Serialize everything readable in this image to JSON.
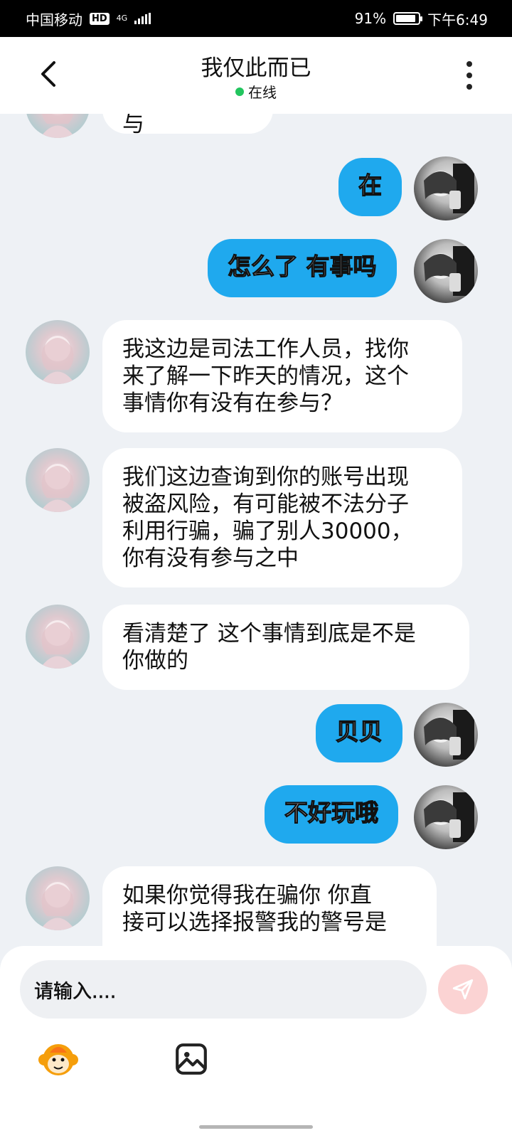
{
  "status_bar": {
    "carrier": "中国移动",
    "hd": "HD",
    "network": "4G",
    "battery": "91%",
    "battery_level": 0.91,
    "time": "下午6:49"
  },
  "header": {
    "title": "我仅此而已",
    "status": "在线",
    "status_color": "#22c55e"
  },
  "messages": [
    {
      "side": "them",
      "text": "有没有在参与"
    },
    {
      "side": "me",
      "text": "在"
    },
    {
      "side": "me",
      "text": "怎么了 有事吗"
    },
    {
      "side": "them",
      "lines": [
        "我这边是司法工作人员，找你",
        "来了解一下昨天的情况，这个",
        "事情你有没有在参与？"
      ]
    },
    {
      "side": "them",
      "lines": [
        "我们这边查询到你的账号出现",
        "被盗风险，有可能被不法分子",
        "利用行骗，骗了别人30000，",
        "你有没有参与之中"
      ]
    },
    {
      "side": "them",
      "lines": [
        "看清楚了 这个事情到底是不是",
        "你做的"
      ]
    },
    {
      "side": "me",
      "text": "贝贝"
    },
    {
      "side": "me",
      "text": "不好玩哦"
    },
    {
      "side": "them",
      "lines": [
        "如果你觉得我在骗你 你直",
        "接可以选择报警我的警号是"
      ]
    }
  ],
  "composer": {
    "placeholder": "请输入....",
    "send_icon": "send-icon",
    "emoji_icon": "monkey-emoji-icon",
    "image_icon": "image-icon"
  },
  "colors": {
    "my_bubble": "#1fa9ee",
    "their_bubble": "#ffffff",
    "background": "#eef1f5"
  }
}
